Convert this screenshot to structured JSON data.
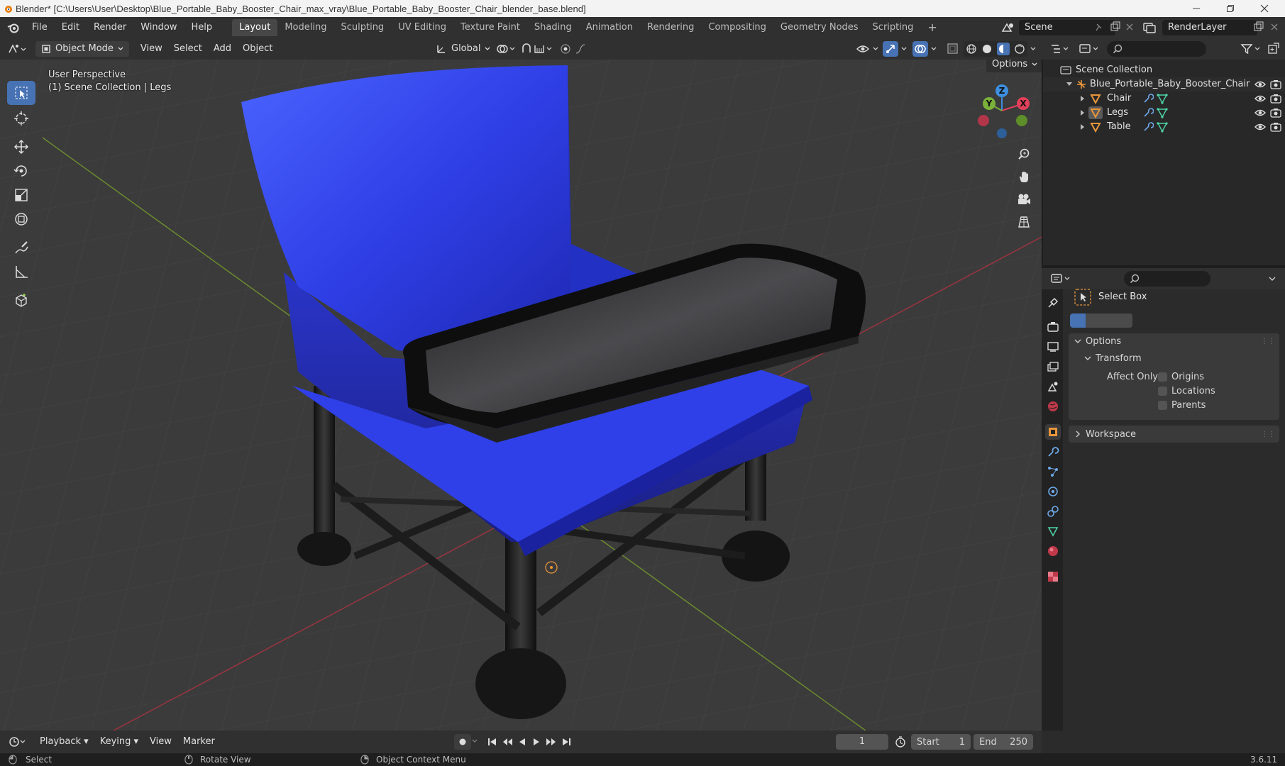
{
  "window": {
    "title": "Blender* [C:\\Users\\User\\Desktop\\Blue_Portable_Baby_Booster_Chair_max_vray\\Blue_Portable_Baby_Booster_Chair_blender_base.blend]"
  },
  "menu": [
    "File",
    "Edit",
    "Render",
    "Window",
    "Help"
  ],
  "workspaces": [
    "Layout",
    "Modeling",
    "Sculpting",
    "UV Editing",
    "Texture Paint",
    "Shading",
    "Animation",
    "Rendering",
    "Compositing",
    "Geometry Nodes",
    "Scripting"
  ],
  "active_workspace": "Layout",
  "scene": {
    "name": "Scene",
    "render_layer": "RenderLayer"
  },
  "viewport_header": {
    "mode": "Object Mode",
    "menus": [
      "View",
      "Select",
      "Add",
      "Object"
    ],
    "transform_orientation": "Global",
    "options_label": "Options"
  },
  "viewport": {
    "perspective": "User Perspective",
    "collection_info": "(1) Scene Collection | Legs",
    "gizmo_axes": [
      "Z",
      "Y",
      "X"
    ]
  },
  "outliner": {
    "root": "Scene Collection",
    "collection": "Blue_Portable_Baby_Booster_Chair",
    "children": [
      "Chair",
      "Legs",
      "Table"
    ]
  },
  "properties": {
    "tool_name": "Select Box",
    "options_label": "Options",
    "transform_label": "Transform",
    "affect_only_label": "Affect Only",
    "checkboxes": [
      "Origins",
      "Locations",
      "Parents"
    ],
    "workspace_label": "Workspace"
  },
  "timeline": {
    "menus": [
      "Playback",
      "Keying",
      "View",
      "Marker"
    ],
    "current_frame": "1",
    "start_label": "Start",
    "start": "1",
    "end_label": "End",
    "end": "250"
  },
  "statusbar": {
    "select": "Select",
    "rotate": "Rotate View",
    "context": "Object Context Menu",
    "version": "3.6.11"
  },
  "colors": {
    "accent": "#4772b3",
    "chair_blue": "#2f3fe6",
    "object_orange": "#e8963c",
    "axis_x": "#e0405a",
    "axis_y": "#7bb13a",
    "axis_z": "#3d8fe0"
  }
}
